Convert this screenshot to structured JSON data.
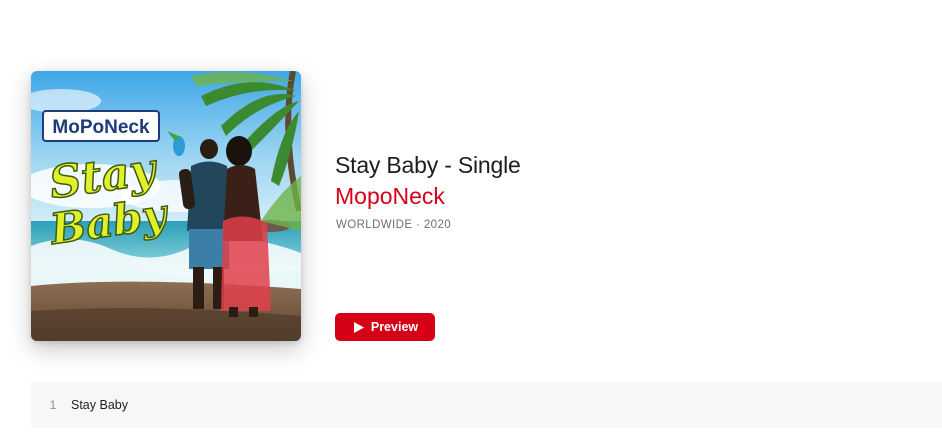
{
  "album": {
    "title": "Stay Baby - Single",
    "artist": "MopoNeck",
    "meta": "WORLDWIDE · 2020",
    "artwork": {
      "logo_text": "MoPoNeck",
      "cover_text_line1": "Stay",
      "cover_text_line2": "Baby"
    }
  },
  "actions": {
    "preview_label": "Preview",
    "preview_icon": "play-icon"
  },
  "tracks": [
    {
      "number": "1",
      "title": "Stay Baby"
    }
  ],
  "colors": {
    "accent": "#d60017",
    "title": "#1d1d1f",
    "meta": "#6e6e73",
    "track_row_bg": "#f7f7f7"
  }
}
